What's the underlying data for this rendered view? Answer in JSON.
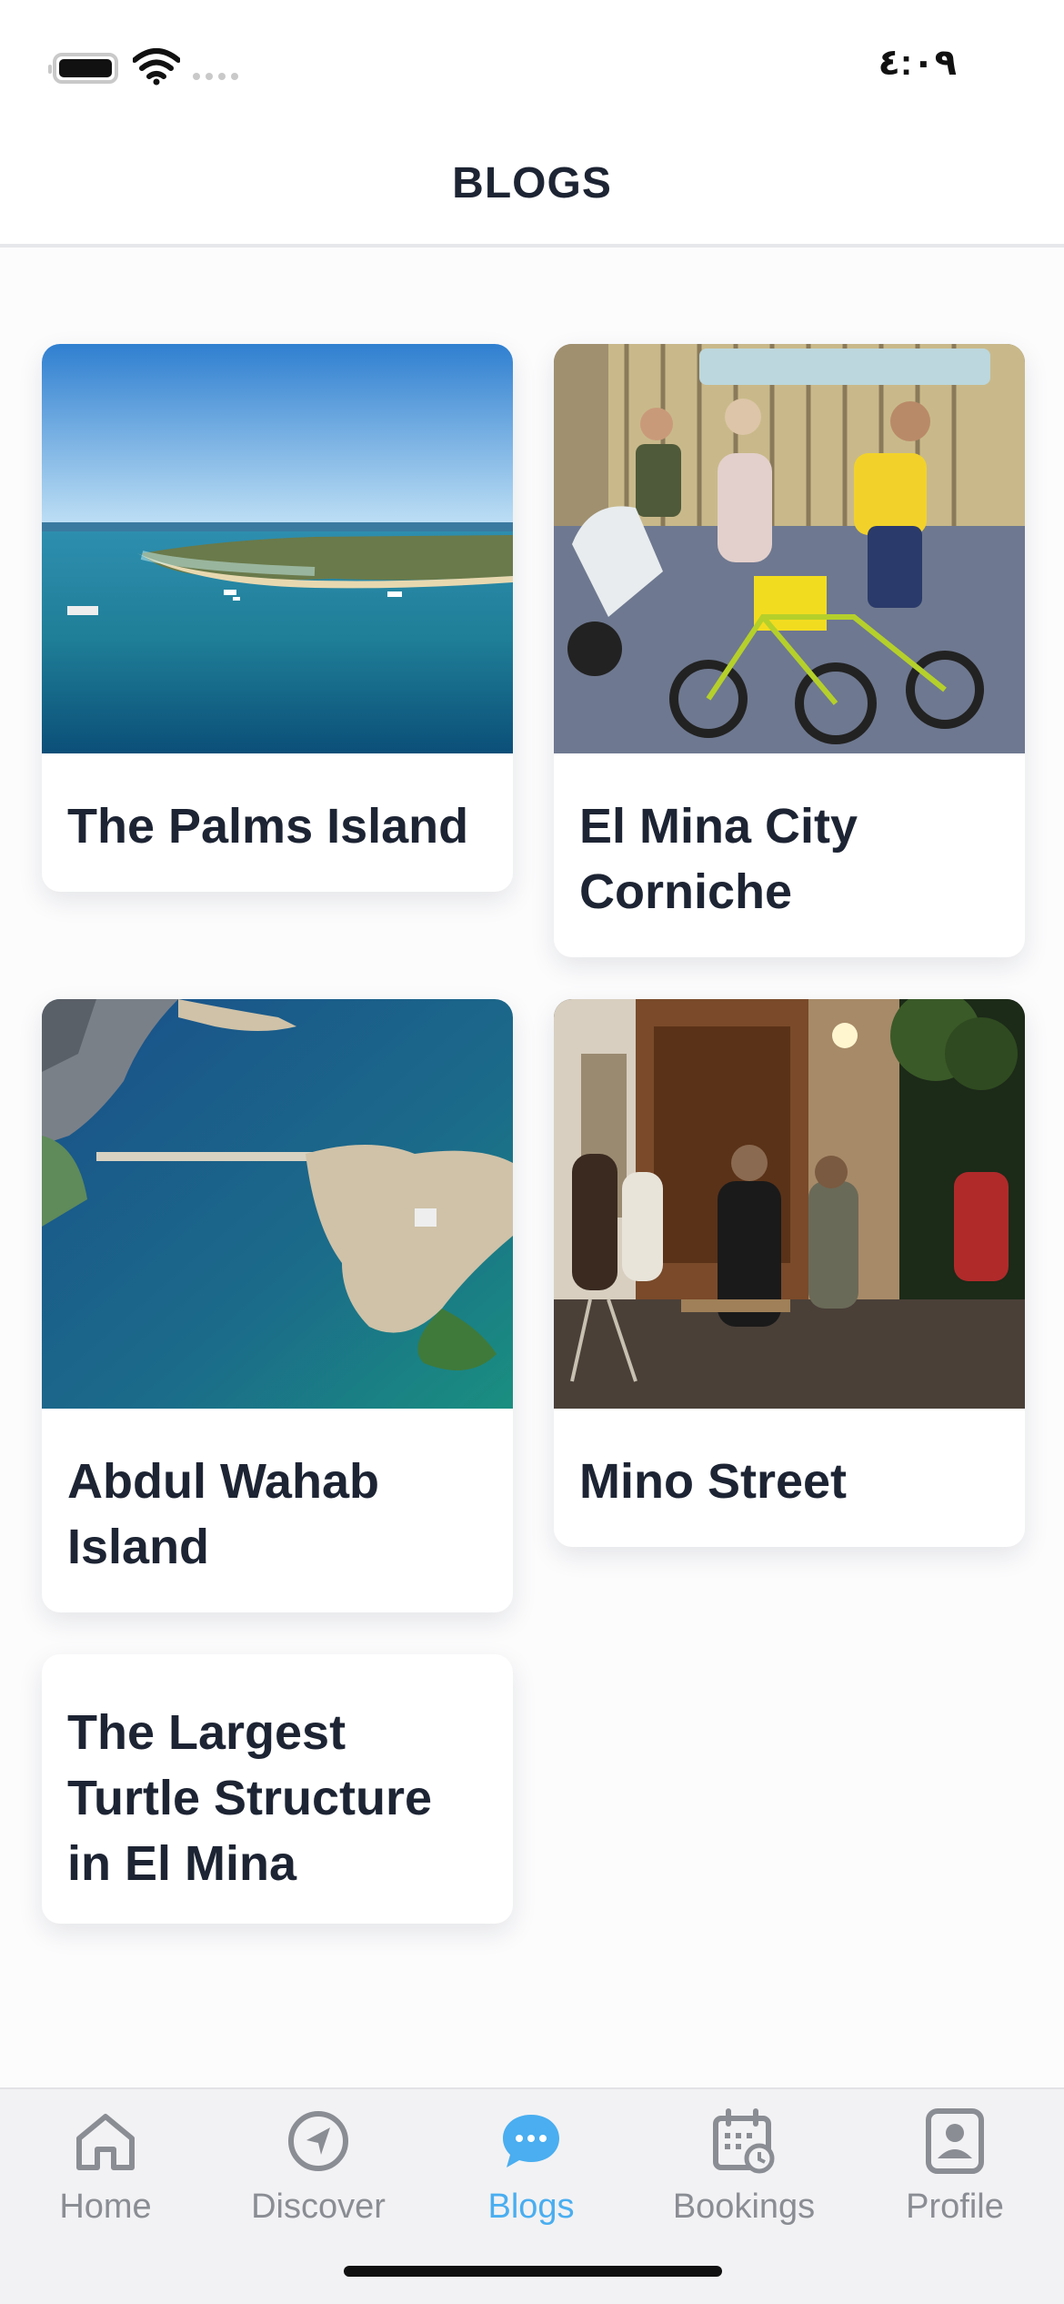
{
  "status_bar": {
    "time": "٤:٠٩"
  },
  "header": {
    "title": "BLOGS"
  },
  "blogs": [
    {
      "title": "The Palms Island",
      "image": "aerial-island-sea-photo"
    },
    {
      "title": "El Mina City Corniche",
      "image": "people-on-bikes-corniche-photo"
    },
    {
      "title": "Abdul Wahab Island",
      "image": "aerial-island-bridge-photo"
    },
    {
      "title": "Mino Street",
      "image": "street-cafe-night-photo"
    },
    {
      "title": "The Largest Turtle Structure in El Mina",
      "image": null
    }
  ],
  "tab_bar": {
    "tabs": [
      {
        "label": "Home",
        "icon": "home-icon"
      },
      {
        "label": "Discover",
        "icon": "compass-icon"
      },
      {
        "label": "Blogs",
        "icon": "chat-bubble-icon",
        "active": true
      },
      {
        "label": "Bookings",
        "icon": "calendar-clock-icon"
      },
      {
        "label": "Profile",
        "icon": "user-badge-icon"
      }
    ]
  },
  "colors": {
    "accent": "#4aaef0",
    "inactive": "#8a8d93",
    "title_text": "#1d2433",
    "background": "#fcfcfd"
  }
}
